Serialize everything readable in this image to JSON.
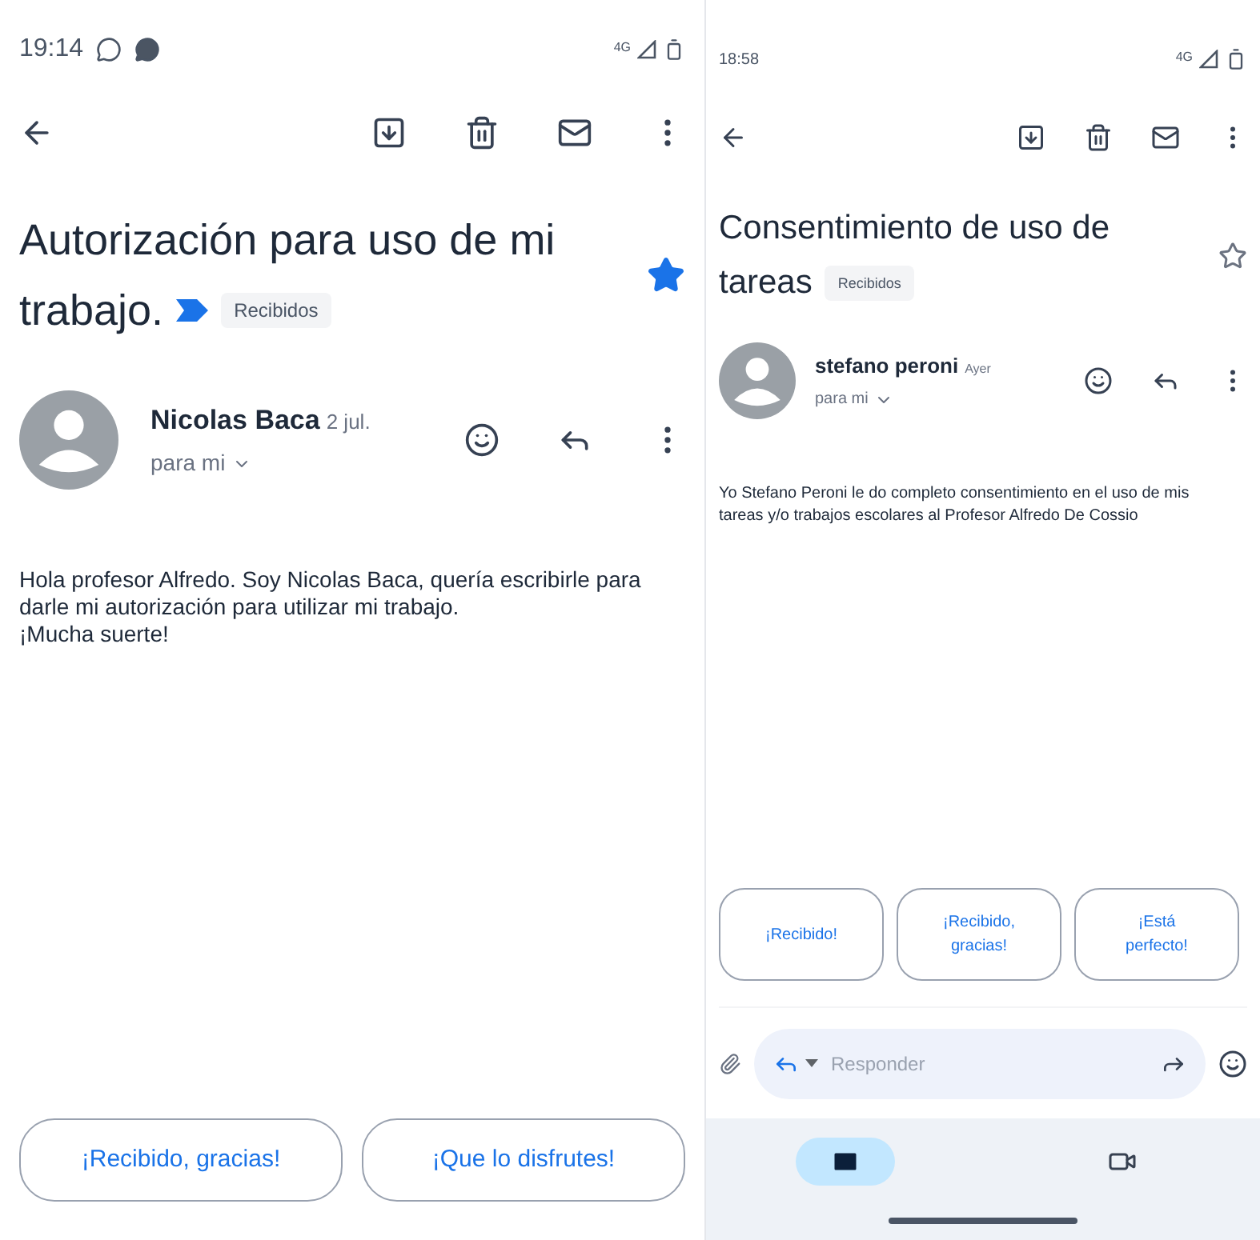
{
  "phones": [
    {
      "status_bar": {
        "time": "19:14",
        "network": "4G",
        "notification_icons": true
      },
      "subject": [
        "Autorización para uso de mi",
        "trabajo."
      ],
      "important": true,
      "label": "Recibidos",
      "starred": true,
      "sender": {
        "name": "Nicolas Baca",
        "date": "2 jul.",
        "recipient": "para mi"
      },
      "body": [
        "Hola profesor Alfredo. Soy Nicolas Baca, quería escribirle para darle mi autorización para utilizar mi trabajo.",
        "¡Mucha suerte!"
      ],
      "smart_replies": [
        "¡Recibido, gracias!",
        "¡Que lo disfrutes!"
      ]
    },
    {
      "status_bar": {
        "time": "18:58",
        "network": "4G",
        "notification_icons": false
      },
      "subject": [
        "Consentimiento de uso de",
        "tareas"
      ],
      "important": false,
      "label": "Recibidos",
      "starred": false,
      "sender": {
        "name": "stefano peroni",
        "date": "Ayer",
        "recipient": "para mi"
      },
      "body": [
        "Yo Stefano Peroni le do completo consentimiento en el uso de mis tareas y/o trabajos escolares al Profesor Alfredo De Cossio"
      ],
      "smart_replies": [
        "¡Recibido!",
        "¡Recibido, gracias!",
        "¡Está perfecto!"
      ],
      "compose": {
        "placeholder": "Responder"
      },
      "bottom_nav": [
        {
          "kind": "mail",
          "selected": true
        },
        {
          "kind": "meet",
          "selected": false
        }
      ]
    }
  ]
}
